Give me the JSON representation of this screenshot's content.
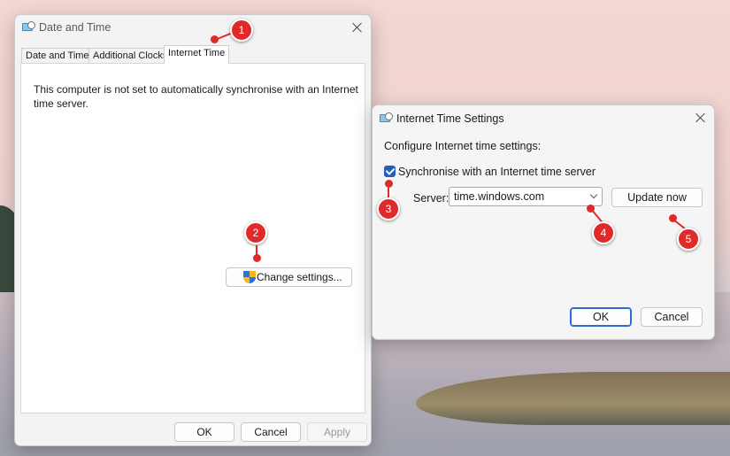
{
  "date_time_dialog": {
    "title": "Date and Time",
    "tabs": [
      {
        "label": "Date and Time"
      },
      {
        "label": "Additional Clocks"
      },
      {
        "label": "Internet Time"
      }
    ],
    "message_line1": "This computer is not set to automatically synchronise with an Internet",
    "message_line2": "time server.",
    "change_settings_label": "Change settings...",
    "ok_label": "OK",
    "cancel_label": "Cancel",
    "apply_label": "Apply"
  },
  "internet_time_dialog": {
    "title": "Internet Time Settings",
    "heading": "Configure Internet time settings:",
    "sync_checkbox_label": "Synchronise with an Internet time server",
    "sync_checked": true,
    "server_label": "Server:",
    "server_value": "time.windows.com",
    "update_now_label": "Update now",
    "ok_label": "OK",
    "cancel_label": "Cancel"
  },
  "annotations": [
    "1",
    "2",
    "3",
    "4",
    "5"
  ],
  "icons": {
    "app": "date-time-control-panel-icon",
    "uac": "uac-shield-icon",
    "close": "close-icon",
    "dropdown": "chevron-down-icon"
  },
  "colors": {
    "marker": "#e02a2a",
    "checkbox": "#1f5fbf",
    "primary_border": "#2f6ad3"
  }
}
